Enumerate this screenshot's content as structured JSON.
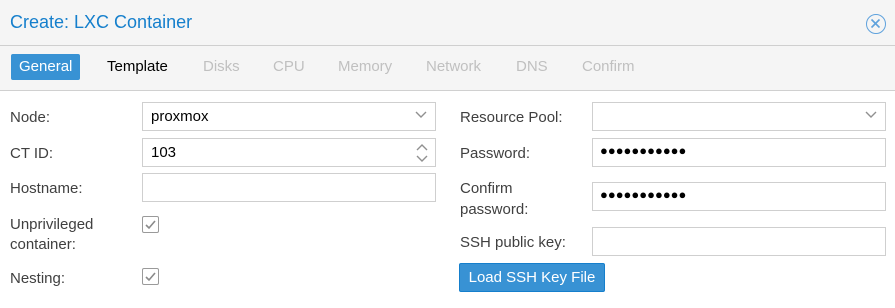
{
  "window": {
    "title": "Create: LXC Container"
  },
  "tabs": [
    {
      "label": "General"
    },
    {
      "label": "Template"
    },
    {
      "label": "Disks"
    },
    {
      "label": "CPU"
    },
    {
      "label": "Memory"
    },
    {
      "label": "Network"
    },
    {
      "label": "DNS"
    },
    {
      "label": "Confirm"
    }
  ],
  "left": {
    "node": {
      "label": "Node:",
      "value": "proxmox"
    },
    "ctid": {
      "label": "CT ID:",
      "value": "103"
    },
    "hostname": {
      "label": "Hostname:",
      "value": ""
    },
    "unprivileged": {
      "label_line1": "Unprivileged",
      "label_line2": "container:",
      "checked": true
    },
    "nesting": {
      "label": "Nesting:",
      "checked": true
    }
  },
  "right": {
    "resource_pool": {
      "label": "Resource Pool:",
      "value": ""
    },
    "password": {
      "label": "Password:",
      "masked": "●●●●●●●●●●●"
    },
    "confirm_password": {
      "label_line1": "Confirm",
      "label_line2": "password:",
      "masked": "●●●●●●●●●●●"
    },
    "ssh_key": {
      "label": "SSH public key:",
      "value": ""
    },
    "load_ssh_button": {
      "label": "Load SSH Key File"
    }
  },
  "icons": {
    "close": "close-circle-icon",
    "dropdown": "chevron-down-icon",
    "spinner": "spinner-icon",
    "check": "check-icon"
  },
  "colors": {
    "accent": "#157fcc",
    "tab_active_bg": "#3892d4",
    "tab_disabled": "#c0c0c0",
    "label": "#404040"
  }
}
